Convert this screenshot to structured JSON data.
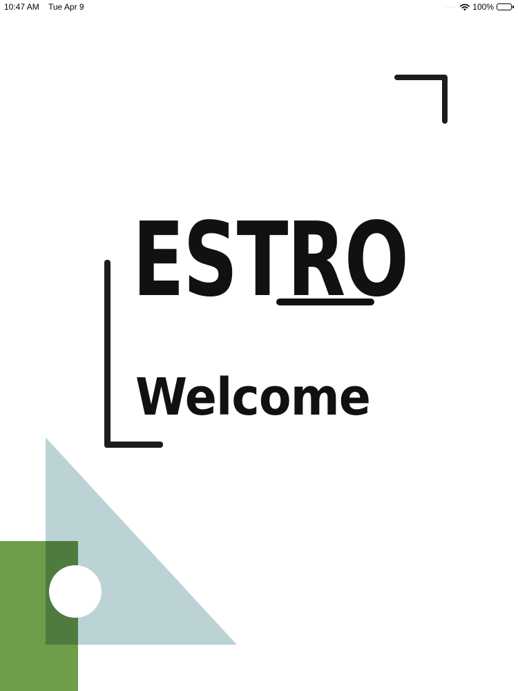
{
  "status_bar": {
    "time": "10:47 AM",
    "date": "Tue Apr 9",
    "battery_percent": "100%",
    "signal_icon": "signal-dots-icon",
    "wifi_icon": "wifi-icon",
    "battery_icon": "battery-icon"
  },
  "splash": {
    "logo_text": "ESTRO",
    "heading": "Welcome"
  },
  "colors": {
    "text": "#111111",
    "bracket": "#1c1c1c",
    "triangle": "#bcd3d6",
    "green": "#6e9e4a",
    "green_dark": "#4f7c3e",
    "circle": "#ffffff"
  }
}
